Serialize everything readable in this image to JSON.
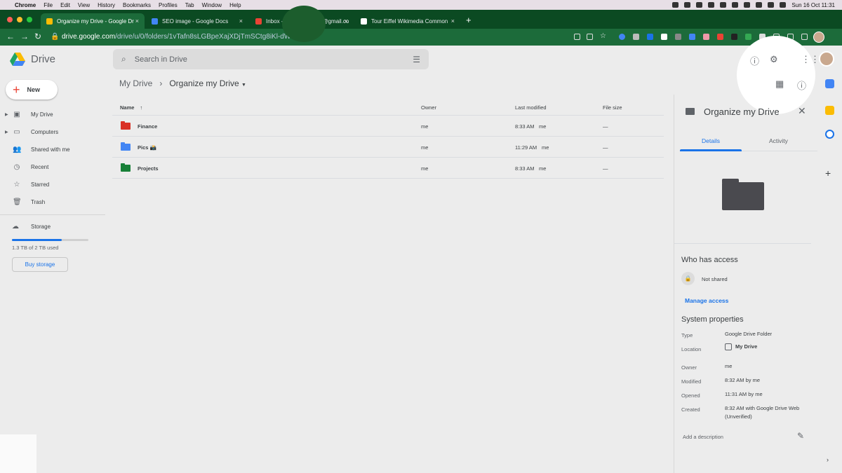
{
  "menubar": {
    "app": "Chrome",
    "items": [
      "File",
      "Edit",
      "View",
      "History",
      "Bookmarks",
      "Profiles",
      "Tab",
      "Window",
      "Help"
    ],
    "clock": "Sun 16 Oct  11:31"
  },
  "tabs": [
    {
      "title": "Organize my Drive - Google Dr",
      "close": "×",
      "color": "#fbbc04"
    },
    {
      "title": "SEO image - Google Docs",
      "close": "×",
      "color": "#4285f4"
    },
    {
      "title": "Inbox -",
      "suffix": "@gmail.co",
      "close": "×",
      "color": "#ea4335"
    },
    {
      "title": "Tour Eiffel Wikimedia Common",
      "close": "×",
      "color": "#ffffff"
    }
  ],
  "newtab": "+",
  "address": {
    "host": "drive.google.com",
    "path": "/drive/u/0/folders/1vTafn8sLGBpeXajXDjTmSCtg8iKl-dWB"
  },
  "drive": {
    "logo_text": "Drive",
    "search_placeholder": "Search in Drive",
    "new_label": "New",
    "sidebar": [
      {
        "label": "My Drive",
        "icon": "my-drive-icon",
        "glyph": "▣"
      },
      {
        "label": "Computers",
        "icon": "computer-icon",
        "glyph": "▭"
      },
      {
        "label": "Shared with me",
        "icon": "people-icon",
        "glyph": "👥"
      },
      {
        "label": "Recent",
        "icon": "clock-icon",
        "glyph": "◷"
      },
      {
        "label": "Starred",
        "icon": "star-icon",
        "glyph": "☆"
      },
      {
        "label": "Trash",
        "icon": "trash-icon",
        "glyph": "🗑"
      }
    ],
    "storage": {
      "label": "Storage",
      "used_text": "1.3 TB of 2 TB used",
      "fraction": 0.65,
      "buy": "Buy storage"
    },
    "breadcrumb": {
      "root": "My Drive",
      "current": "Organize my Drive"
    },
    "table": {
      "headers": {
        "name": "Name",
        "owner": "Owner",
        "modified": "Last modified",
        "size": "File size"
      },
      "rows": [
        {
          "name": "Finance",
          "owner": "me",
          "modified": "8:33 AM",
          "modified_by": "me",
          "size": "—",
          "color": "#d93025"
        },
        {
          "name": "Pics 📸",
          "owner": "me",
          "modified": "11:29 AM",
          "modified_by": "me",
          "size": "—",
          "color": "#4285f4"
        },
        {
          "name": "Projects",
          "owner": "me",
          "modified": "8:33 AM",
          "modified_by": "me",
          "size": "—",
          "color": "#188038"
        }
      ]
    },
    "details": {
      "title": "Organize my Drive",
      "tab_details": "Details",
      "tab_activity": "Activity",
      "who_has_access": "Who has access",
      "sharing": "Not shared",
      "manage_access": "Manage access",
      "system_properties": "System properties",
      "props": [
        {
          "k": "Type",
          "v": "Google Drive Folder"
        },
        {
          "k": "Location",
          "v": "My Drive"
        },
        {
          "k": "Owner",
          "v": "me"
        },
        {
          "k": "Modified",
          "v": "8:32 AM by me"
        },
        {
          "k": "Opened",
          "v": "11:31 AM by me"
        },
        {
          "k": "Created",
          "v": "8:32 AM with Google Drive Web (Unverified)"
        }
      ],
      "add_description": "Add a description"
    }
  },
  "colors": {
    "accent": "#1a73e8",
    "chrome_frame": "#0b4a22",
    "toolbar": "#1c6b3a"
  }
}
